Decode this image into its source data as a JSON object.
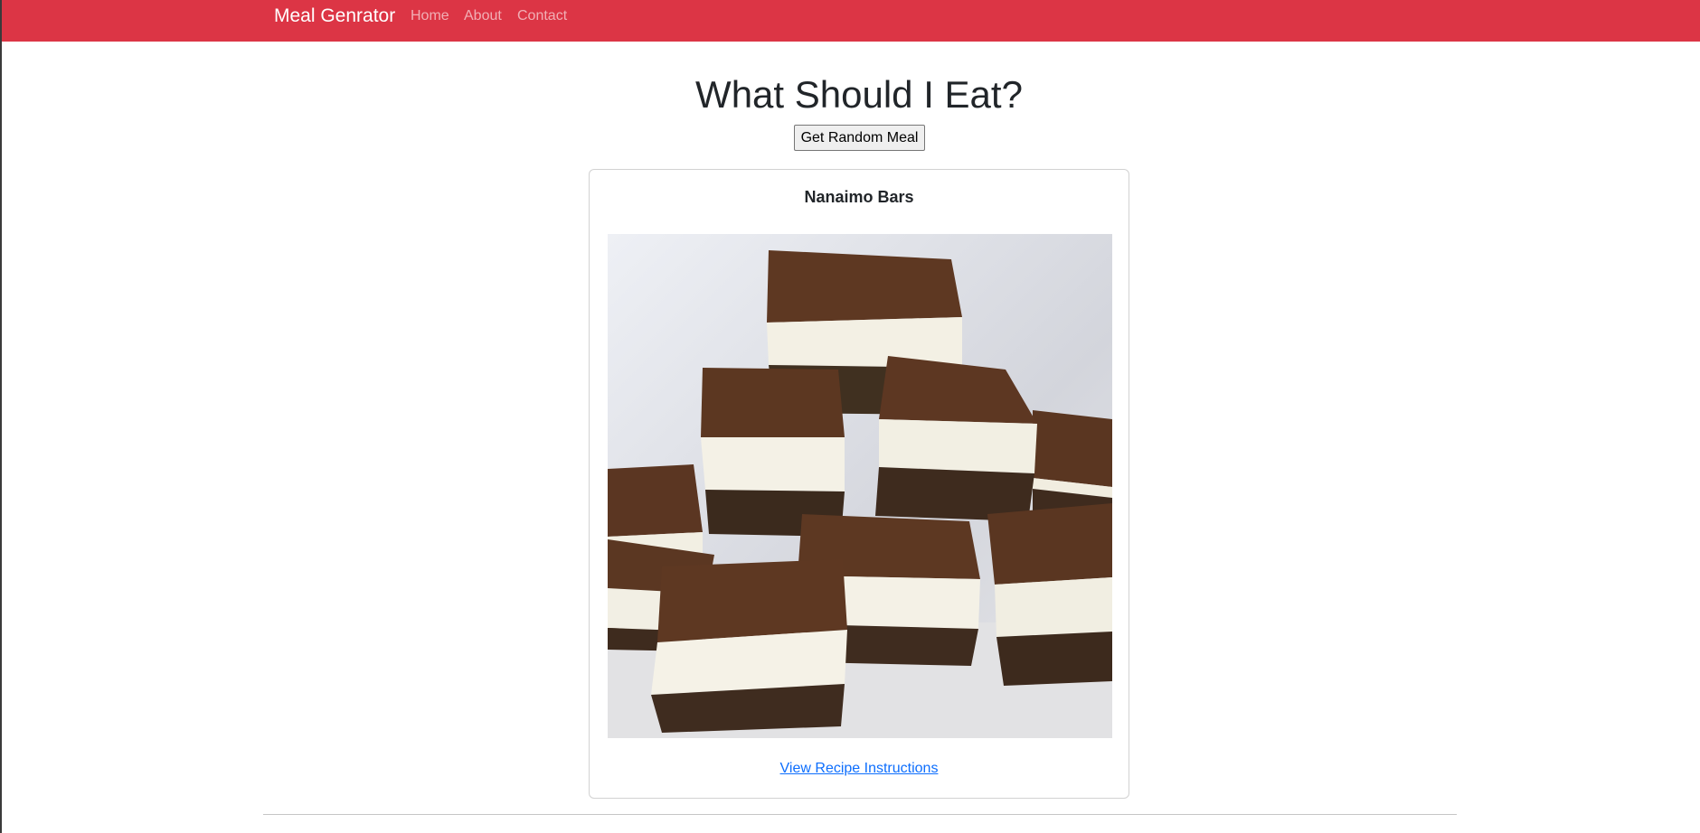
{
  "navbar": {
    "brand": "Meal Genrator",
    "links": [
      {
        "label": "Home"
      },
      {
        "label": "About"
      },
      {
        "label": "Contact"
      }
    ],
    "color": "#dc3545"
  },
  "main": {
    "title": "What Should I Eat?",
    "random_button": "Get Random Meal"
  },
  "meal_card": {
    "name": "Nanaimo Bars",
    "image_alt": "Nanaimo Bars",
    "recipe_link": "View Recipe Instructions"
  },
  "colors": {
    "link": "#0d6efd",
    "heading": "#212529"
  }
}
